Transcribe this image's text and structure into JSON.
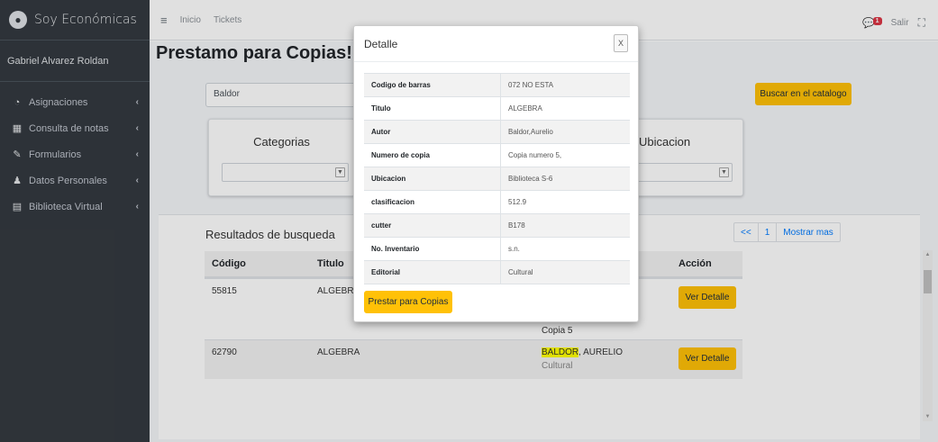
{
  "brand": {
    "name": "Soy Económicas",
    "logo_icon": "circle-logo-icon"
  },
  "user": {
    "name": "Gabriel Alvarez Roldan"
  },
  "sidebar": {
    "items": [
      {
        "label": "Asignaciones",
        "icon": "dashboard-icon"
      },
      {
        "label": "Consulta de notas",
        "icon": "table-icon"
      },
      {
        "label": "Formularios",
        "icon": "edit-icon"
      },
      {
        "label": "Datos Personales",
        "icon": "user-icon"
      },
      {
        "label": "Biblioteca Virtual",
        "icon": "book-icon"
      }
    ]
  },
  "topbar": {
    "links": [
      "Inicio",
      "Tickets"
    ],
    "badge": "1",
    "logout": "Salir"
  },
  "page": {
    "title": "Prestamo para Copias!",
    "search_value": "Baldor",
    "catalog_button": "Buscar en el catalogo"
  },
  "filters": {
    "left_label": "Categorias",
    "right_label": "Ubicacion"
  },
  "results": {
    "title": "Resultados de busqueda",
    "pagination": [
      "<<",
      "1",
      "Mostrar mas"
    ],
    "headers": [
      "Código",
      "Titulo",
      "",
      "Acción"
    ],
    "rows": [
      {
        "code": "55815",
        "title": "ALGEBRA",
        "extra": "Copia 5",
        "action": "Ver Detalle"
      },
      {
        "code": "62790",
        "title": "ALGEBRA",
        "author_hl": "BALDOR",
        "author_rest": ", AURELIO",
        "publisher": "Cultural",
        "action": "Ver Detalle"
      }
    ]
  },
  "modal": {
    "title": "Detalle",
    "close": "X",
    "rows": [
      {
        "key": "Codigo de barras",
        "value": "072 NO ESTA"
      },
      {
        "key": "Titulo",
        "value": "ALGEBRA"
      },
      {
        "key": "Autor",
        "value": "Baldor,Aurelio"
      },
      {
        "key": "Numero de copia",
        "value": "Copia numero 5,"
      },
      {
        "key": "Ubicacion",
        "value": "Biblioteca S-6"
      },
      {
        "key": "clasificacion",
        "value": "512.9"
      },
      {
        "key": "cutter",
        "value": "B178"
      },
      {
        "key": "No. Inventario",
        "value": "s.n."
      },
      {
        "key": "Editorial",
        "value": "Cultural"
      }
    ],
    "button": "Prestar para Copias"
  },
  "colors": {
    "sidebar": "#343a40",
    "accent": "#ffc107",
    "link": "#007bff",
    "highlight": "#ffff00"
  }
}
